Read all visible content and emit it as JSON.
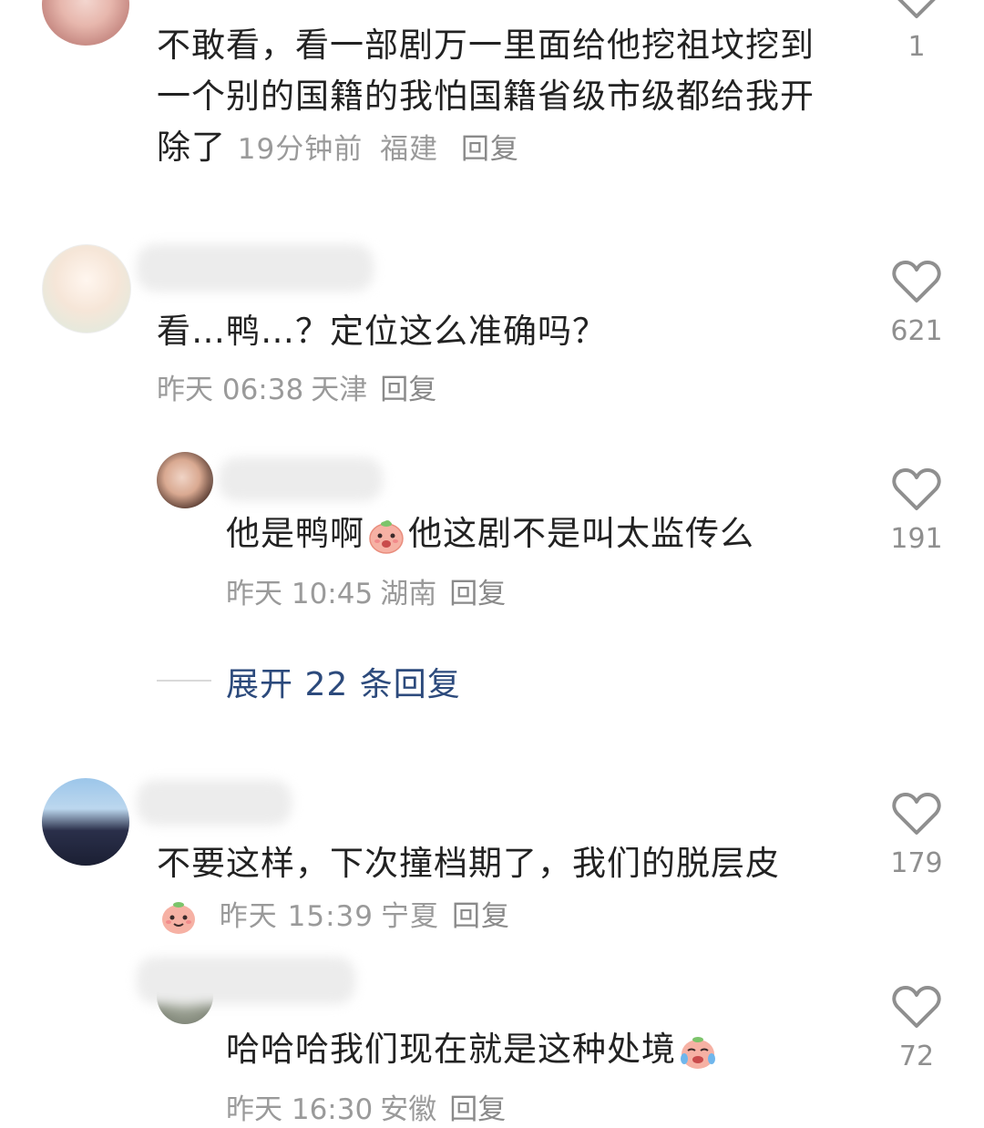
{
  "comments": [
    {
      "text": "不敢看，看一部剧万一里面给他挖祖坟挖到一个别的国籍的我怕国籍省级市级都给我开除了",
      "time": "19分钟前",
      "region": "福建",
      "reply_label": "回复",
      "likes": "1"
    },
    {
      "text": "看…鸭…？定位这么准确吗？",
      "time": "昨天 06:38",
      "region": "天津",
      "reply_label": "回复",
      "likes": "621"
    },
    {
      "text_before": "他是鸭啊",
      "text_after": "他这剧不是叫太监传么",
      "time": "昨天 10:45",
      "region": "湖南",
      "reply_label": "回复",
      "likes": "191"
    },
    {
      "text_before": "不要这样，下次撞档期了，我们的脱层皮",
      "time": "昨天 15:39",
      "region": "宁夏",
      "reply_label": "回复",
      "likes": "179"
    },
    {
      "text_before": "哈哈哈我们现在就是这种处境",
      "time": "昨天 16:30",
      "region": "安徽",
      "reply_label": "回复",
      "likes": "72"
    }
  ],
  "expand_replies": "展开 22 条回复",
  "colors": {
    "text": "#222222",
    "meta": "#9a9a9a",
    "link": "#2c4a7c",
    "icon": "#8f8f8f"
  }
}
